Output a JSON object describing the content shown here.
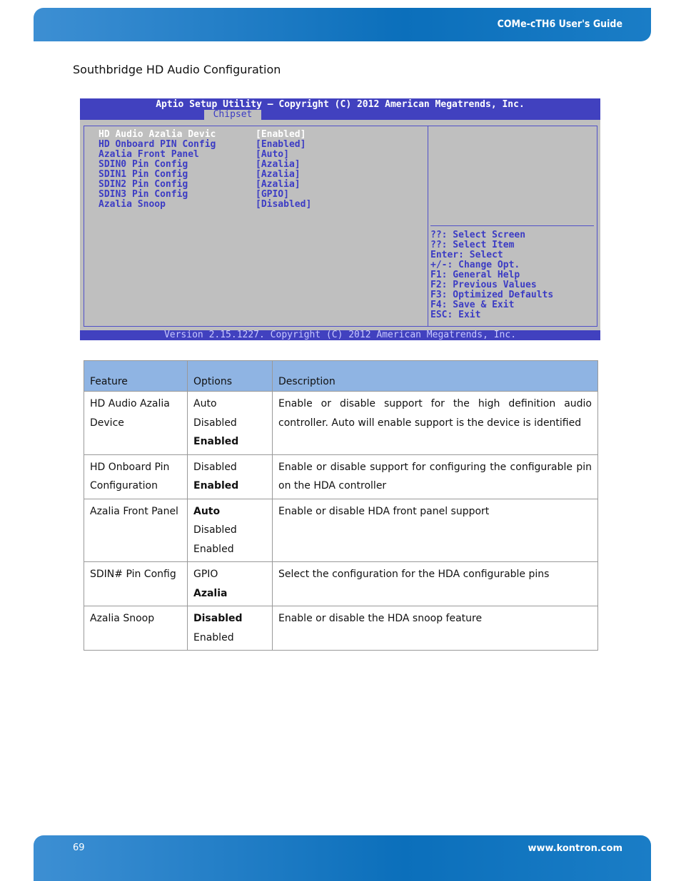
{
  "header": {
    "title": "COMe-cTH6 User's Guide"
  },
  "section_title": "Southbridge HD Audio Configuration",
  "bios": {
    "title": "Aptio Setup Utility – Copyright (C) 2012 American Megatrends, Inc.",
    "tab": "Chipset",
    "items": [
      {
        "label": "HD Audio Azalia Devic",
        "value": "[Enabled]"
      },
      {
        "label": "HD Onboard PIN Config",
        "value": "[Enabled]"
      },
      {
        "label": "Azalia Front Panel",
        "value": "[Auto]"
      },
      {
        "label": "SDIN0 Pin Config",
        "value": "[Azalia]"
      },
      {
        "label": "SDIN1 Pin Config",
        "value": "[Azalia]"
      },
      {
        "label": "SDIN2 Pin Config",
        "value": "[Azalia]"
      },
      {
        "label": "SDIN3 Pin Config",
        "value": "[GPIO]"
      },
      {
        "label": "Azalia Snoop",
        "value": "[Disabled]"
      }
    ],
    "help": [
      "??: Select Screen",
      "??: Select Item",
      "Enter: Select",
      "+/-: Change Opt.",
      "F1: General Help",
      "F2: Previous Values",
      "F3: Optimized Defaults",
      "F4: Save & Exit",
      "ESC: Exit"
    ],
    "footer": "Version 2.15.1227. Copyright (C) 2012 American Megatrends, Inc."
  },
  "table": {
    "headers": [
      "Feature",
      "Options",
      "Description"
    ],
    "rows": [
      {
        "feature": "HD Audio Azalia Device",
        "options": [
          "Auto",
          "Disabled",
          "Enabled"
        ],
        "default": "Enabled",
        "description": "Enable or disable support for the high definition audio controller. Auto will enable support is the device is identified"
      },
      {
        "feature": "HD Onboard Pin Configuration",
        "options": [
          "Disabled",
          "Enabled"
        ],
        "default": "Enabled",
        "description": "Enable or disable support for configuring the configurable pin on the HDA controller"
      },
      {
        "feature": "Azalia Front Panel",
        "options": [
          "Auto",
          "Disabled",
          "Enabled"
        ],
        "default": "Auto",
        "description": "Enable or disable HDA front panel support"
      },
      {
        "feature": "SDIN# Pin Config",
        "options": [
          "GPIO",
          "Azalia"
        ],
        "default": "Azalia",
        "description": "Select the configuration for the HDA configurable pins"
      },
      {
        "feature": "Azalia Snoop",
        "options": [
          "Disabled",
          "Enabled"
        ],
        "default": "Disabled",
        "description": "Enable or disable the HDA snoop feature"
      }
    ]
  },
  "footer": {
    "page": "69",
    "url": "www.kontron.com"
  }
}
